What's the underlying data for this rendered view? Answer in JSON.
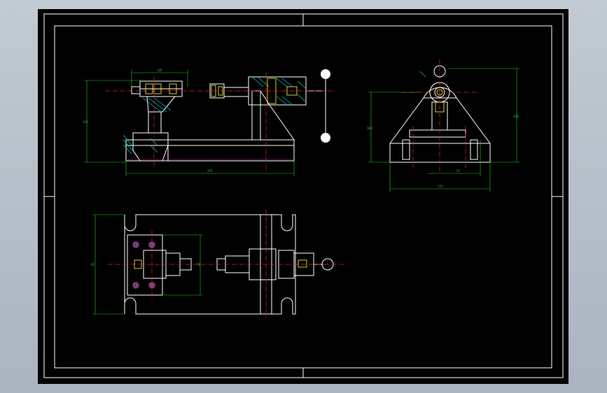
{
  "colors": {
    "background": "#b3bcc6",
    "sheet": "#000000",
    "border": "#ffffff",
    "outline": "#ffffff",
    "dimension": "#1fd11f",
    "centerline": "#ff2020",
    "hatch": "#00c8c8",
    "detail": "#ffff40",
    "hidden": "#ff40ff"
  },
  "icons": {
    "hole": "circle-outline",
    "handle_knob": "filled-circle"
  },
  "dimensions": {
    "front_top": "145",
    "front_height": "120",
    "front_overall": "375",
    "side_left": "180",
    "side_right": "230",
    "side_width": "55",
    "side_base": "170",
    "plan_height": "85",
    "plan_inner": "70"
  }
}
